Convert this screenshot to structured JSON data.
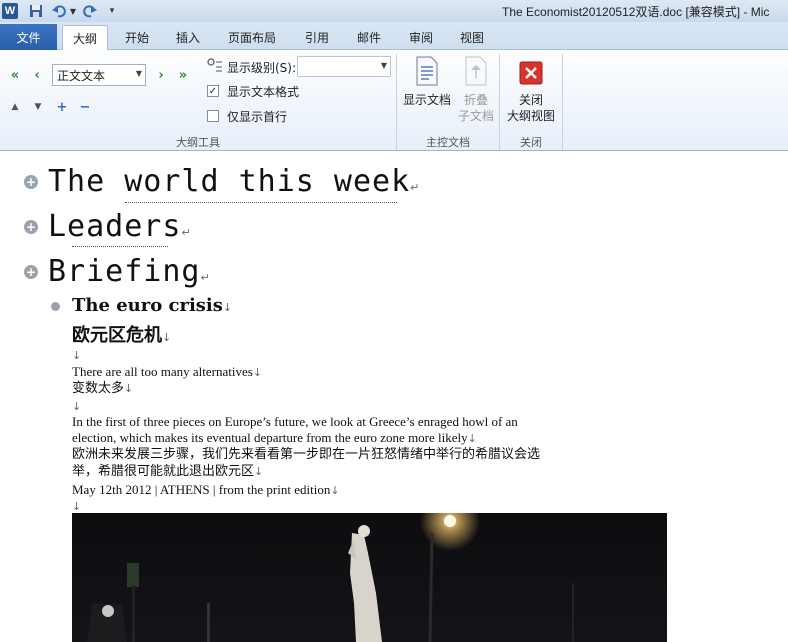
{
  "window": {
    "title": "The Economist20120512双语.doc [兼容模式] - Mic",
    "logo": "W"
  },
  "tabs": {
    "file": "文件",
    "outline": "大纲",
    "start": "开始",
    "insert": "插入",
    "layout": "页面布局",
    "references": "引用",
    "mailings": "邮件",
    "review": "审阅",
    "view": "视图"
  },
  "ribbon": {
    "outline_tools": {
      "group_label": "大纲工具",
      "level_value": "正文文本",
      "show_level_label": "显示级别(S):",
      "show_level_value": "",
      "show_text_format_label": "显示文本格式",
      "show_text_format_checked": true,
      "show_first_line_label": "仅显示首行",
      "show_first_line_checked": false
    },
    "master_doc": {
      "group_label": "主控文档",
      "show_document": "显示文档",
      "collapse_line1": "折叠",
      "collapse_line2": "子文档"
    },
    "close": {
      "group_label": "关闭",
      "close_line1": "关闭",
      "close_line2": "大纲视图"
    }
  },
  "document": {
    "headings": [
      "The world this week",
      "Leaders",
      "Briefing"
    ],
    "section_title": "The euro crisis",
    "section_title_cn": "欧元区危机",
    "subtitle": "There are all too many alternatives",
    "subtitle_cn": "变数太多",
    "para_line1": "In the first of three pieces on Europe’s future, we look at Greece’s enraged howl of an",
    "para_line2": "election, which makes its eventual departure from the euro zone more likely",
    "para_cn_line1": "欧洲未来发展三步骤，我们先来看看第一步即在一片狂怒情绪中举行的希腊议会选",
    "para_cn_line2": "举，希腊很可能就此退出欧元区",
    "dateline": "May 12th 2012 | ATHENS | from the print edition",
    "para_mark": "↵",
    "line_mark": "↓"
  },
  "icons": {
    "save": "save-icon",
    "undo": "undo-icon",
    "redo": "redo-icon"
  }
}
